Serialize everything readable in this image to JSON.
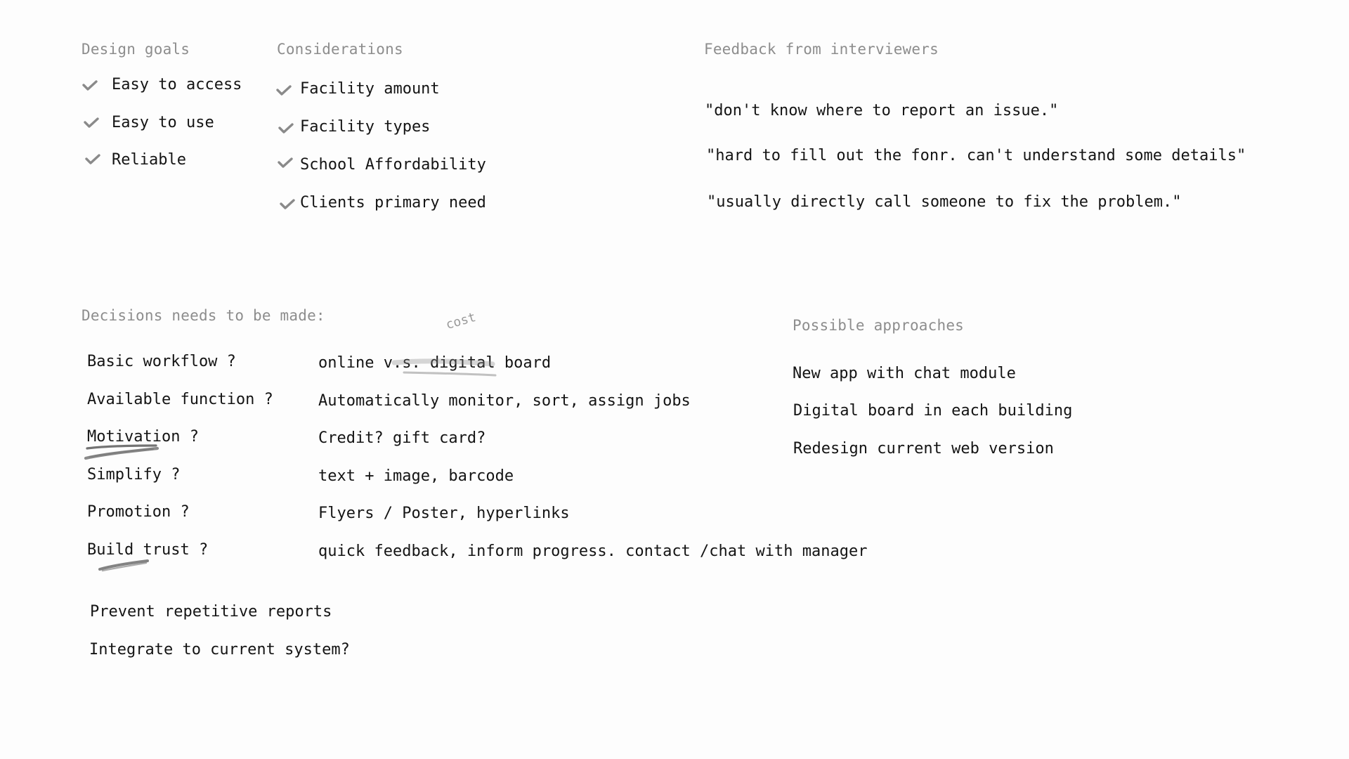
{
  "design_goals": {
    "heading": "Design goals",
    "items": [
      "Easy to access",
      "Easy to use",
      "Reliable"
    ],
    "check_icon": "check-icon"
  },
  "considerations": {
    "heading": "Considerations",
    "items": [
      "Facility amount",
      "Facility types",
      "School Affordability",
      "Clients primary need"
    ],
    "check_icon": "check-icon"
  },
  "feedback": {
    "heading": "Feedback from interviewers",
    "quotes": [
      "\"don't know where to report an issue.\"",
      "\"hard to fill out the fonr. can't understand some details\"",
      "\"usually directly call someone to fix the problem.\""
    ]
  },
  "decisions": {
    "heading": "Decisions needs to be made:",
    "annotation": "cost",
    "questions": [
      "Basic workflow ?",
      "Available function ?",
      "Motivation ?",
      "Simplify ?",
      "Promotion ?",
      "Build trust ?"
    ],
    "answers": [
      "online v.s. digital board",
      "Automatically monitor, sort, assign jobs",
      "Credit? gift card?",
      "text + image, barcode",
      "Flyers / Poster, hyperlinks",
      "quick feedback, inform progress. contact /chat with manager"
    ],
    "extra": [
      "Prevent repetitive reports",
      "Integrate to current system?"
    ]
  },
  "approaches": {
    "heading": "Possible approaches",
    "items": [
      "New app with chat module",
      "Digital board in each building",
      "Redesign current web version"
    ]
  },
  "colors": {
    "heading": "#8d8d8d",
    "text": "#141414",
    "check": "#8a8a8a",
    "scribble": "#5a5a5a"
  }
}
